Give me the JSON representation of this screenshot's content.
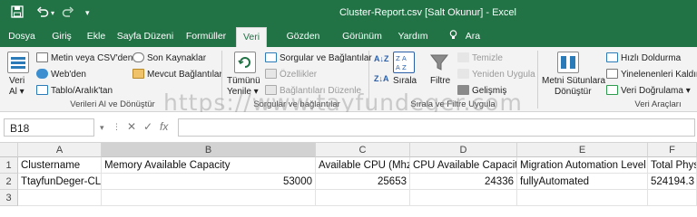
{
  "title_bar": {
    "title": "Cluster-Report.csv  [Salt Okunur]  -  Excel",
    "qa_save_icon": "save-icon",
    "qa_undo_icon": "undo-icon",
    "qa_redo_icon": "redo-icon",
    "qa_more": "▾",
    "brand_color": "#217346"
  },
  "tabs": [
    {
      "label": "Dosya"
    },
    {
      "label": "Giriş"
    },
    {
      "label": "Ekle"
    },
    {
      "label": "Sayfa Düzeni"
    },
    {
      "label": "Formüller"
    },
    {
      "label": "Veri",
      "active": true
    },
    {
      "label": "Gözden Geçir"
    },
    {
      "label": "Görünüm"
    },
    {
      "label": "Yardım"
    },
    {
      "label": "Ara"
    }
  ],
  "ribbon": {
    "get_data": {
      "line1": "Veri",
      "line2": "Al ▾"
    },
    "from_csv": "Metin veya CSV'den",
    "from_web": "Web'den",
    "from_table": "Tablo/Aralık'tan",
    "recent_sources": "Son Kaynaklar",
    "existing_connections": "Mevcut Bağlantılar",
    "group_get_transform": "Verileri Al ve Dönüştür",
    "refresh_all": {
      "line1": "Tümünü",
      "line2": "Yenile ▾"
    },
    "queries_connections": "Sorgular ve Bağlantılar",
    "properties": "Özellikler",
    "edit_links": "Bağlantıları Düzenle",
    "group_queries": "Sorgular ve bağlantılar",
    "sort_az": "A↓Z",
    "sort_za": "Z↓A",
    "sort": "Sırala",
    "filter": "Filtre",
    "clear": "Temizle",
    "reapply": "Yeniden Uygula",
    "advanced": "Gelişmiş",
    "group_sort_filter": "Sırala ve Filtre Uygula",
    "text_to_columns": {
      "line1": "Metni Sütunlara",
      "line2": "Dönüştür"
    },
    "flash_fill": "Hızlı Doldurma",
    "remove_duplicates": "Yinelenenleri Kaldır",
    "data_validation": "Veri Doğrulama  ▾",
    "group_data_tools": "Veri Araçları"
  },
  "watermark": "https://www.tayfundeger.com",
  "formula_bar": {
    "name_box": "B18",
    "cancel": "✕",
    "enter": "✓",
    "fx": "fx",
    "formula": ""
  },
  "sheet": {
    "columns": [
      "A",
      "B",
      "C",
      "D",
      "E",
      "F"
    ],
    "rows": [
      {
        "num": "1",
        "cells": [
          "Clustername",
          "Memory Available Capacity",
          "Available CPU (Mhz)",
          "CPU Available Capacity",
          "Migration Automation Level",
          "Total Phys"
        ]
      },
      {
        "num": "2",
        "cells": [
          "TtayfunDeger-CLS",
          "53000",
          "25653",
          "24336",
          "fullyAutomated",
          "524194.3"
        ]
      },
      {
        "num": "3",
        "cells": [
          "",
          "",
          "",
          "",
          "",
          ""
        ]
      }
    ]
  }
}
